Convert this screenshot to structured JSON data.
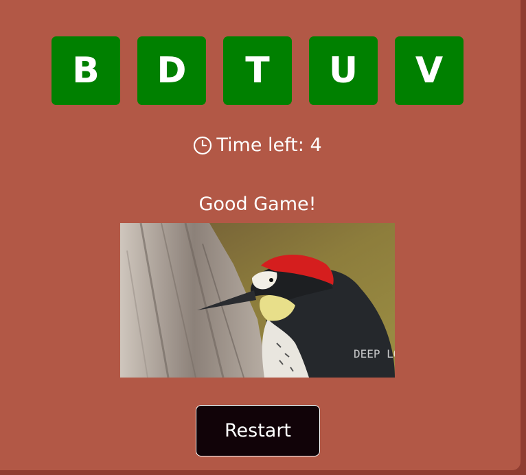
{
  "letters": [
    "B",
    "D",
    "T",
    "U",
    "V"
  ],
  "timer": {
    "icon": "clock-icon",
    "text": "Time left: 4"
  },
  "result": {
    "message": "Good Game!",
    "image_watermark": "DEEP LOOK"
  },
  "restart_label": "Restart",
  "colors": {
    "background": "#b25846",
    "tile": "#008000",
    "button": "#110308",
    "text": "#ffffff"
  }
}
